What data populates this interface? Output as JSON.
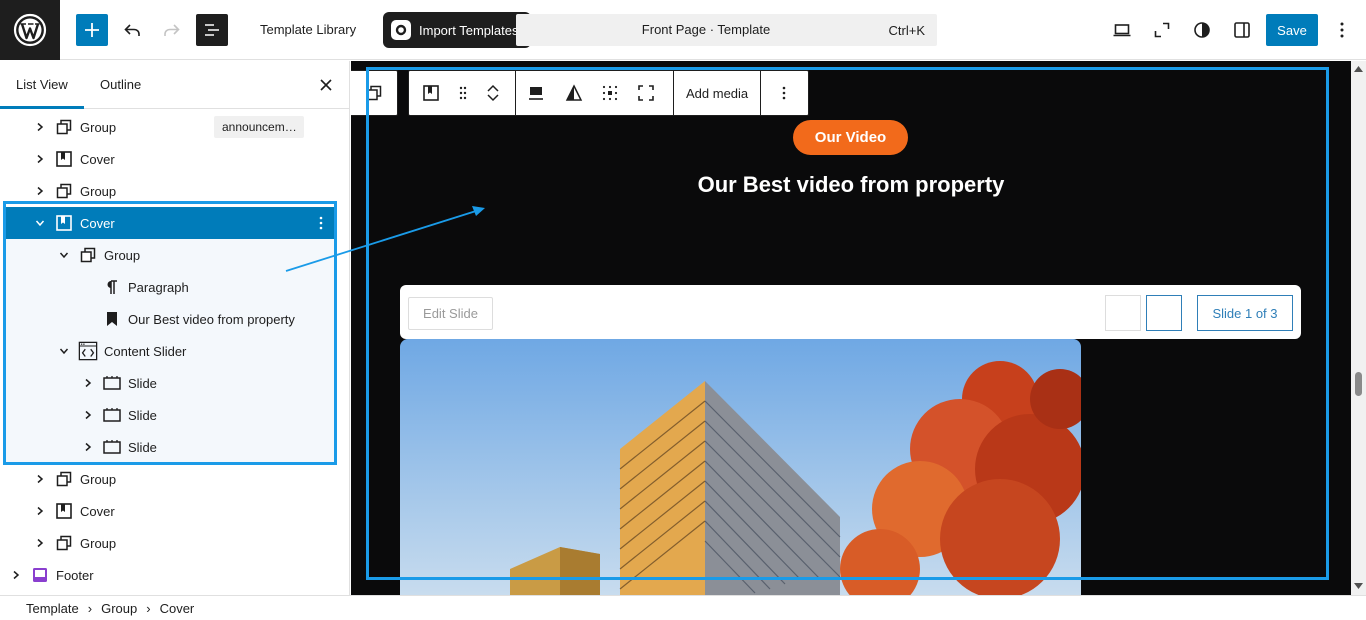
{
  "topbar": {
    "template_library": "Template Library",
    "import_templates": "Import Templates",
    "command_title": "Front Page · Template",
    "shortcut": "Ctrl+K",
    "save": "Save"
  },
  "sidebar": {
    "tabs": [
      "List View",
      "Outline"
    ],
    "anchor_badge": "announcem…",
    "rows": [
      {
        "label": "Group",
        "icon": "group-icon",
        "level": 2,
        "chevron": "right"
      },
      {
        "label": "Cover",
        "icon": "cover-icon",
        "level": 2,
        "chevron": "right"
      },
      {
        "label": "Group",
        "icon": "group-icon",
        "level": 2,
        "chevron": "right"
      },
      {
        "label": "Cover",
        "icon": "cover-icon",
        "level": 2,
        "chevron": "down",
        "selected": true
      },
      {
        "label": "Group",
        "icon": "group-icon",
        "level": 3,
        "chevron": "down"
      },
      {
        "label": "Paragraph",
        "icon": "paragraph-icon",
        "level": 4,
        "chevron": ""
      },
      {
        "label": "Our Best video from property",
        "icon": "bookmark-icon",
        "level": 4,
        "chevron": ""
      },
      {
        "label": "Content Slider",
        "icon": "content-slider-icon",
        "level": 3,
        "chevron": "down"
      },
      {
        "label": "Slide",
        "icon": "slide-icon",
        "level": 4,
        "chevron": "right"
      },
      {
        "label": "Slide",
        "icon": "slide-icon",
        "level": 4,
        "chevron": "right"
      },
      {
        "label": "Slide",
        "icon": "slide-icon",
        "level": 4,
        "chevron": "right"
      },
      {
        "label": "Group",
        "icon": "group-icon",
        "level": 2,
        "chevron": "right"
      },
      {
        "label": "Cover",
        "icon": "cover-icon",
        "level": 2,
        "chevron": "right"
      },
      {
        "label": "Group",
        "icon": "group-icon",
        "level": 2,
        "chevron": "right"
      },
      {
        "label": "Footer",
        "icon": "footer-icon",
        "level": 1,
        "chevron": "right"
      }
    ]
  },
  "canvas": {
    "toolbar_add_media": "Add media",
    "pill": "Our Video",
    "headline": "Our Best video from property",
    "edit_slide": "Edit Slide",
    "slide_count": "Slide 1 of 3"
  },
  "breadcrumb": [
    "Template",
    "Group",
    "Cover"
  ],
  "colors": {
    "accent": "#007cba",
    "annotation": "#1a9be8",
    "pill": "#f26a1b",
    "canvas_bg": "#0a0a0b"
  }
}
